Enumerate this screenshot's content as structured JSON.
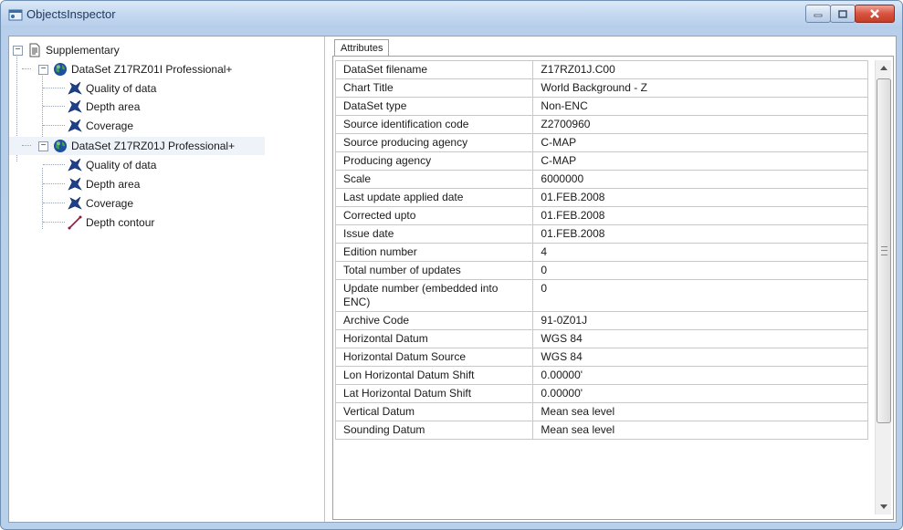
{
  "window": {
    "title": "ObjectsInspector"
  },
  "tree": {
    "root": {
      "label": "Supplementary"
    },
    "datasets": [
      {
        "label": "DataSet Z17RZ01I   Professional+",
        "children": [
          "Quality of data",
          "Depth area",
          "Coverage"
        ]
      },
      {
        "label": "DataSet Z17RZ01J   Professional+",
        "children": [
          "Quality of data",
          "Depth area",
          "Coverage",
          "Depth contour"
        ]
      }
    ]
  },
  "tabs": {
    "attributes": "Attributes"
  },
  "attributes": [
    {
      "key": "DataSet filename",
      "value": "Z17RZ01J.C00"
    },
    {
      "key": "Chart Title",
      "value": "World Background - Z"
    },
    {
      "key": "DataSet type",
      "value": "Non-ENC"
    },
    {
      "key": "Source identification code",
      "value": "Z2700960"
    },
    {
      "key": "Source producing agency",
      "value": "C-MAP"
    },
    {
      "key": "Producing agency",
      "value": "C-MAP"
    },
    {
      "key": "Scale",
      "value": "6000000"
    },
    {
      "key": "Last update applied date",
      "value": "01.FEB.2008"
    },
    {
      "key": "Corrected upto",
      "value": "01.FEB.2008"
    },
    {
      "key": "Issue date",
      "value": "01.FEB.2008"
    },
    {
      "key": "Edition number",
      "value": "4"
    },
    {
      "key": "Total number of updates",
      "value": "0"
    },
    {
      "key": "Update number (embedded into ENC)",
      "value": "0"
    },
    {
      "key": "Archive Code",
      "value": "91-0Z01J"
    },
    {
      "key": "Horizontal Datum",
      "value": "WGS 84"
    },
    {
      "key": "Horizontal Datum Source",
      "value": "WGS 84"
    },
    {
      "key": "Lon Horizontal Datum Shift",
      "value": "0.00000'"
    },
    {
      "key": "Lat Horizontal Datum Shift",
      "value": "0.00000'"
    },
    {
      "key": "Vertical Datum",
      "value": "Mean sea level"
    },
    {
      "key": "Sounding Datum",
      "value": "Mean sea level"
    }
  ],
  "icons": {
    "app": "window-icon",
    "root": "document-icon",
    "dataset": "globe-icon",
    "area_feature": "area-feature-icon",
    "line_feature": "line-feature-icon"
  },
  "colors": {
    "titlebar": "#c4d8f0",
    "close_button": "#d8543f",
    "globe": "#1f4fa0",
    "feature_icon": "#1e3f8a",
    "line_icon": "#8e1b3b"
  }
}
